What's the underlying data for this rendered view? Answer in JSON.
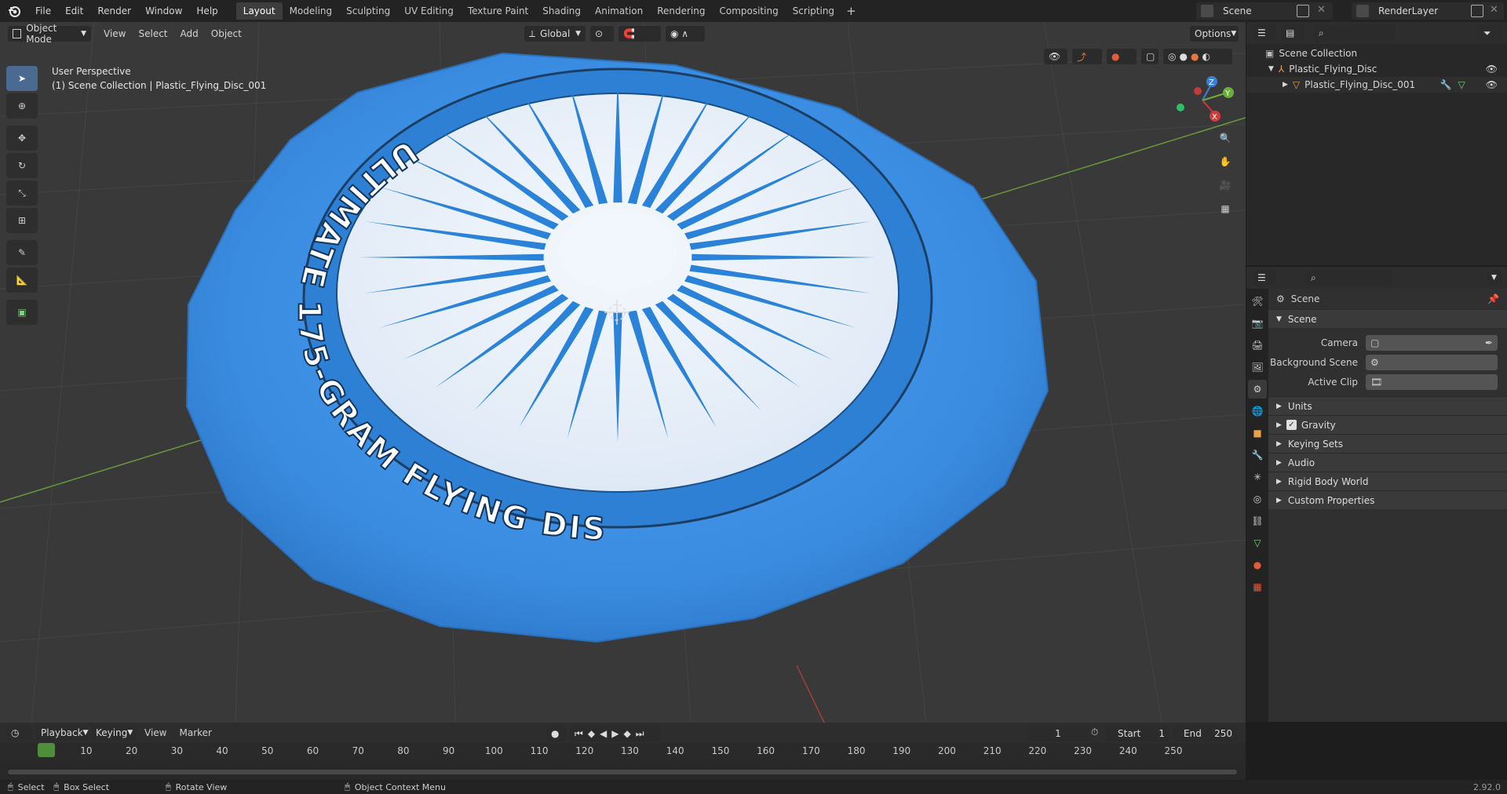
{
  "app": {
    "version": "2.92.0"
  },
  "menu": [
    "File",
    "Edit",
    "Render",
    "Window",
    "Help"
  ],
  "workspaces": {
    "tabs": [
      "Layout",
      "Modeling",
      "Sculpting",
      "UV Editing",
      "Texture Paint",
      "Shading",
      "Animation",
      "Rendering",
      "Compositing",
      "Scripting"
    ],
    "active": "Layout",
    "add": "+"
  },
  "scene_selector": {
    "value": "Scene"
  },
  "renderlayer_selector": {
    "value": "RenderLayer"
  },
  "viewport": {
    "mode": "Object Mode",
    "menu": [
      "View",
      "Select",
      "Add",
      "Object"
    ],
    "transform_orientation": "Global",
    "options_label": "Options",
    "overlay_title": "User Perspective",
    "overlay_subtitle": "(1) Scene Collection | Plastic_Flying_Disc_001",
    "disc_text": "ULTIMATE 175-GRAM FLYING DISC",
    "gizmo_labels": [
      "Z",
      "Y",
      "X"
    ],
    "colors": {
      "disc_blue": "#3c8ee0",
      "label_white": "#e8f0fa",
      "grid_bg": "#393939"
    }
  },
  "outliner": {
    "root": "Scene Collection",
    "items": [
      {
        "label": "Plastic_Flying_Disc"
      },
      {
        "label": "Plastic_Flying_Disc_001"
      }
    ]
  },
  "properties": {
    "context_title": "Scene",
    "sections": {
      "scene": "Scene",
      "camera_label": "Camera",
      "background_scene_label": "Background Scene",
      "active_clip_label": "Active Clip",
      "collapsed": [
        "Units",
        "Gravity",
        "Keying Sets",
        "Audio",
        "Rigid Body World",
        "Custom Properties"
      ]
    },
    "gravity_checked": true
  },
  "timeline": {
    "menus": [
      "Playback",
      "Keying",
      "View",
      "Marker"
    ],
    "current_frame": "1",
    "start_label": "Start",
    "start_value": "1",
    "end_label": "End",
    "end_value": "250",
    "ruler_ticks": [
      "1",
      "10",
      "20",
      "30",
      "40",
      "50",
      "60",
      "70",
      "80",
      "90",
      "100",
      "110",
      "120",
      "130",
      "140",
      "150",
      "160",
      "170",
      "180",
      "190",
      "200",
      "210",
      "220",
      "230",
      "240",
      "250"
    ]
  },
  "statusbar": {
    "select": "Select",
    "box_select": "Box Select",
    "rotate_view": "Rotate View",
    "context_menu": "Object Context Menu"
  }
}
